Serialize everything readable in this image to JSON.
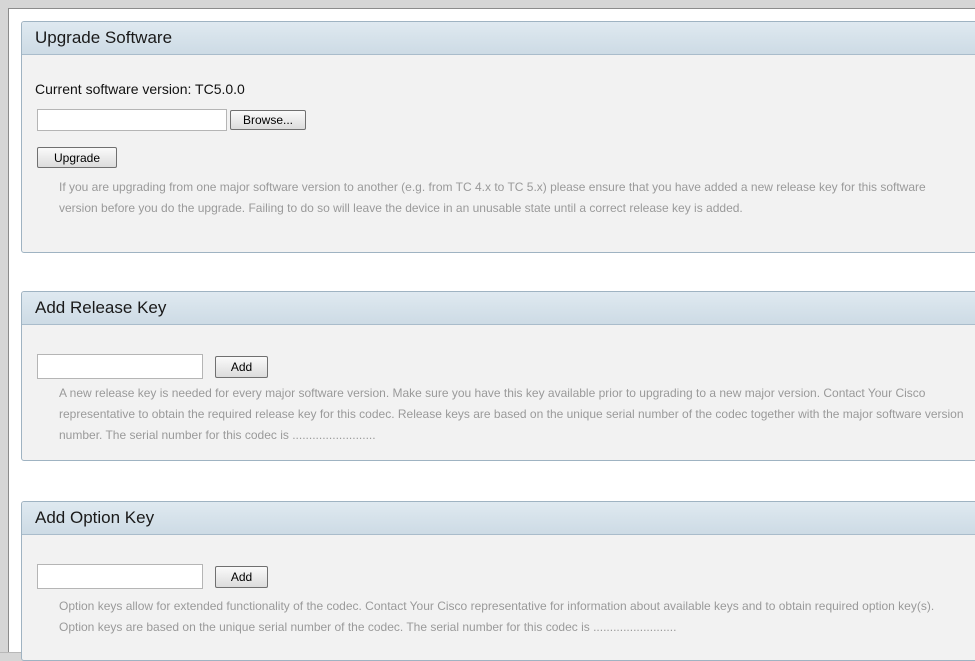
{
  "upgrade": {
    "title": "Upgrade Software",
    "current_version_label": "Current software version: TC5.0.0",
    "file_value": "",
    "browse_label": "Browse...",
    "upgrade_label": "Upgrade",
    "help": "If you are upgrading from one major software version to another (e.g. from TC 4.x to TC 5.x) please ensure that you have added a new release key for this software version before you do the upgrade. Failing to do so will leave the device in an unusable state until a correct release key is added."
  },
  "release_key": {
    "title": "Add Release Key",
    "input_value": "",
    "add_label": "Add",
    "help": "A new release key is needed for every major software version. Make sure you have this key available prior to upgrading to a new major version. Contact Your Cisco representative to obtain the required release key for this codec. Release keys are based on the unique serial number of the codec together with the major software version number. The serial number for this codec is ........................."
  },
  "option_key": {
    "title": "Add Option Key",
    "input_value": "",
    "add_label": "Add",
    "help": "Option keys allow for extended functionality of the codec. Contact Your Cisco representative for information about available keys and to obtain required option key(s). Option keys are based on the unique serial number of the codec. The serial number for this codec is ........................."
  }
}
